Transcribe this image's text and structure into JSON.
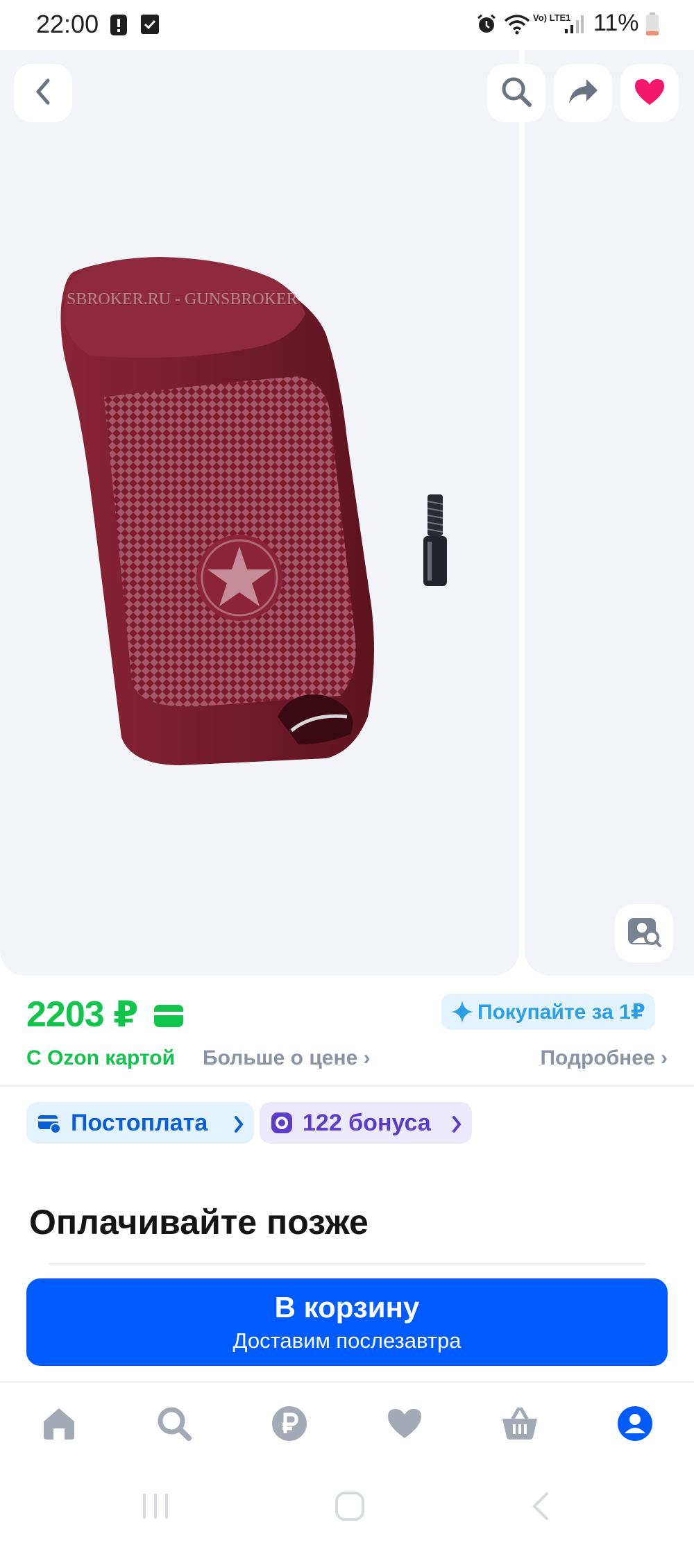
{
  "status_bar": {
    "time": "22:00",
    "battery": "11%",
    "network": "Vo) LTE1",
    "icons": [
      "alert-icon",
      "check-icon",
      "alarm-icon",
      "wifi-icon",
      "signal-icon",
      "battery-icon"
    ]
  },
  "gallery": {
    "watermark": "SBROKER.RU - GUNSBROKER",
    "buttons": [
      "back-icon",
      "search-icon",
      "share-icon",
      "heart-icon",
      "visual-search-icon"
    ],
    "favorite_color": "#f5186a"
  },
  "price": {
    "value": "2203 ₽",
    "note": "С Ozon картой",
    "more": "Больше о цене ›",
    "buy_promo": "Покупайте за 1₽",
    "details": "Подробнее ›",
    "color": "#10c44c"
  },
  "chips": {
    "postpay": "Постоплата",
    "bonus": "122 бонуса"
  },
  "paylater": {
    "title": "Оплачивайте позже"
  },
  "cart": {
    "label": "В корзину",
    "sub": "Доставим послезавтра",
    "color": "#005bff"
  },
  "bottom_nav": {
    "items": [
      "home-icon",
      "search-icon",
      "ruble-icon",
      "favorites-icon",
      "cart-icon",
      "profile-icon"
    ],
    "active": "profile-icon",
    "active_color": "#005bff",
    "inactive_color": "#a3aab5"
  }
}
